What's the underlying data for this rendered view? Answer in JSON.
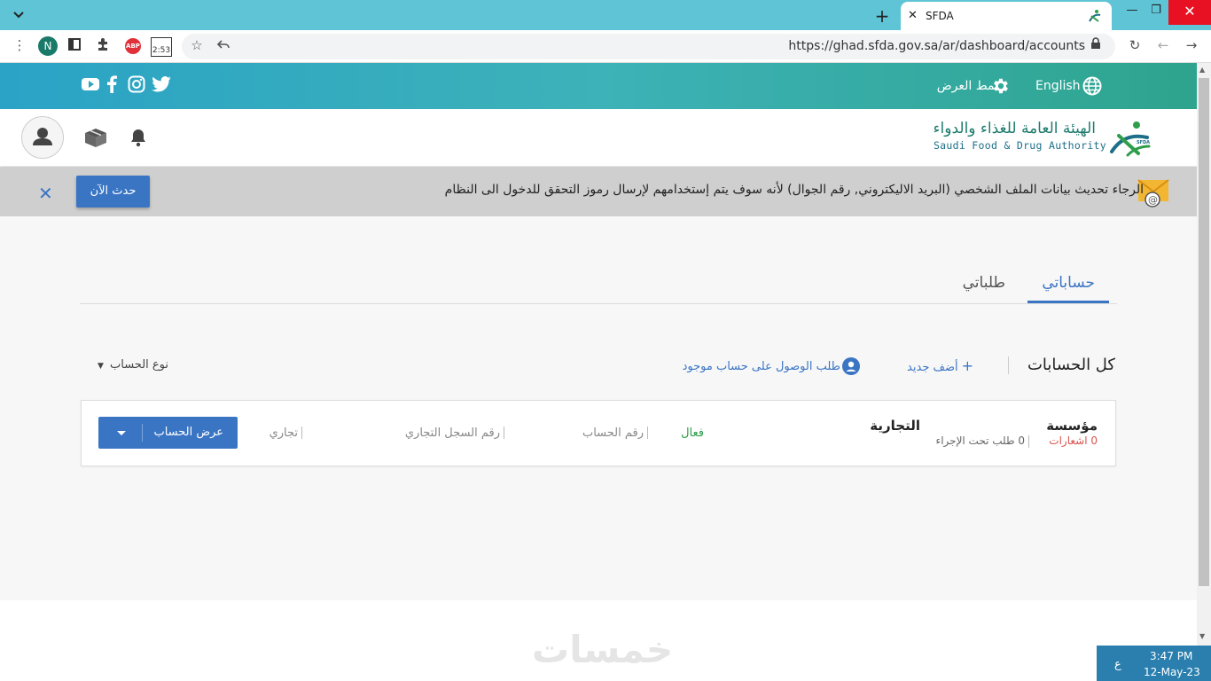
{
  "browser": {
    "tab_title": "SFDA",
    "url": "https://ghad.sfda.gov.sa/ar/dashboard/accounts",
    "profile_initial": "N",
    "abp_label": "ABP",
    "timer_label": "2:53"
  },
  "topbar": {
    "language_label": "English",
    "display_mode_label": "نمط العرض"
  },
  "header": {
    "logo_ar": "الهيئة العامة للغذاء والدواء",
    "logo_en": "Saudi Food & Drug Authority",
    "logo_badge": "SFDA"
  },
  "notice": {
    "text": "الرجاء تحديث بيانات الملف الشخصي (البريد الاليكتروني, رقم الجوال) لأنه سوف يتم إستخدامهم لإرسال رموز التحقق للدخول الى النظام",
    "update_label": "حدث الآن"
  },
  "tabs": [
    {
      "label": "حساباتي"
    },
    {
      "label": "طلباتي"
    }
  ],
  "accounts": {
    "heading": "كل الحسابات",
    "add_new_label": "أضف جديد",
    "request_access_label": "طلب الوصول على حساب موجود",
    "account_type_label": "نوع الحساب"
  },
  "card": {
    "name_line1": "مؤسسة",
    "name_line2": "التجارية",
    "notifications": "0 اشعارات",
    "pending": "0 طلب تحت الإجراء",
    "status": "فعال",
    "account_number_label": "رقم الحساب",
    "cr_number_label": "رقم السجل التجاري",
    "type": "تجاري",
    "view_label": "عرض الحساب"
  },
  "watermark": "خمسات",
  "taskbar": {
    "lang": "ع",
    "time": "3:47 PM",
    "date": "12-May-23"
  },
  "colors": {
    "accent": "#3a75c4",
    "active_status": "#2e9e4a",
    "notification": "#d9534f",
    "tabstrip": "#5ec4d6"
  }
}
